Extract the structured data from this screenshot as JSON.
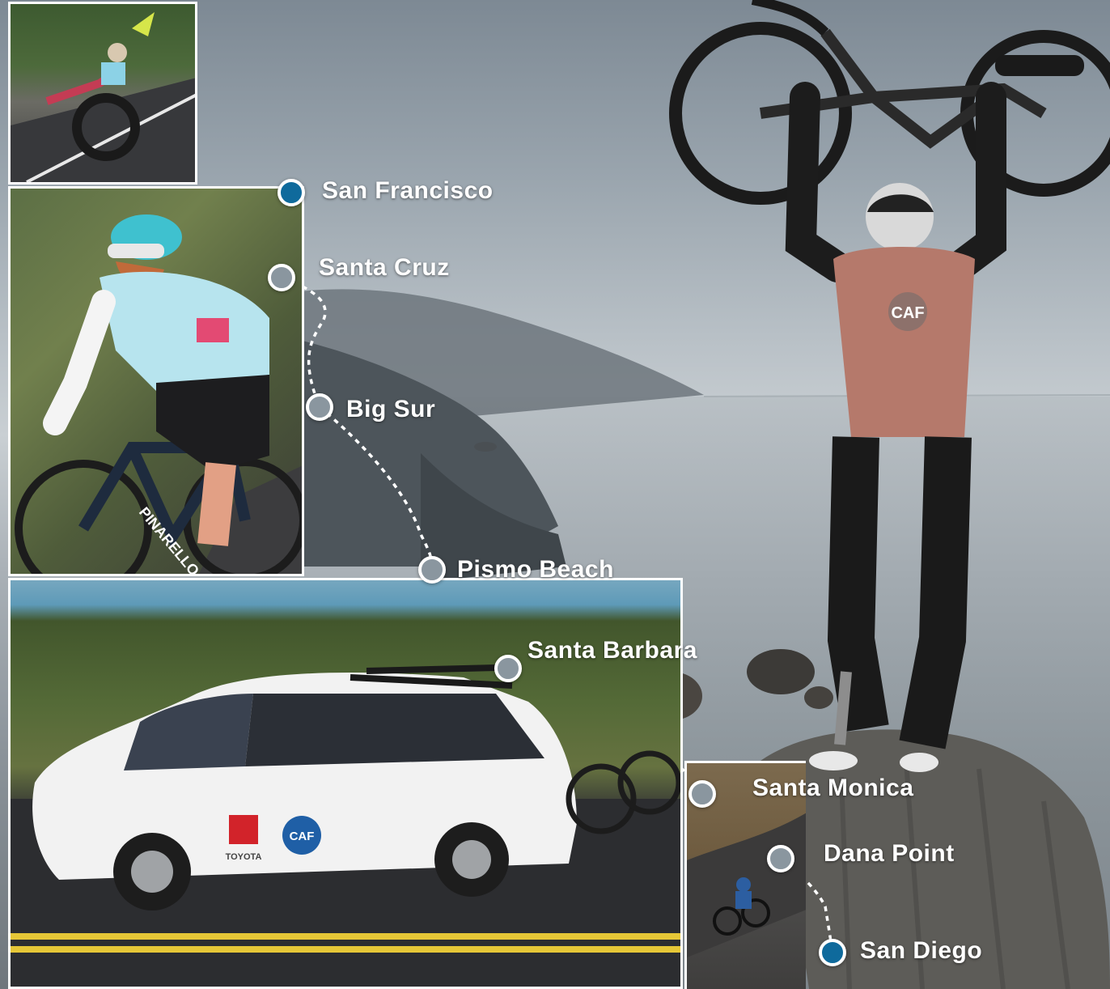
{
  "map": {
    "route_stops": [
      {
        "label": "San Francisco",
        "type": "endpoint"
      },
      {
        "label": "Santa Cruz",
        "type": "stop"
      },
      {
        "label": "Big Sur",
        "type": "stop"
      },
      {
        "label": "Pismo Beach",
        "type": "stop"
      },
      {
        "label": "Santa Barbara",
        "type": "stop"
      },
      {
        "label": "Santa Monica",
        "type": "stop"
      },
      {
        "label": "Dana Point",
        "type": "stop"
      },
      {
        "label": "San Diego",
        "type": "endpoint"
      }
    ],
    "colors": {
      "endpoint_dot": "#0f6a9c",
      "stop_dot": "#8a969f",
      "route_line": "#ffffff",
      "label_text": "#ffffff"
    }
  },
  "photos": {
    "handcycle_caption": "",
    "cyclist_jersey_text": "PINARELLO",
    "van_logo_brand": "TOYOTA",
    "van_logo_org": "CAF",
    "hero_jersey_logo": "CAF"
  }
}
